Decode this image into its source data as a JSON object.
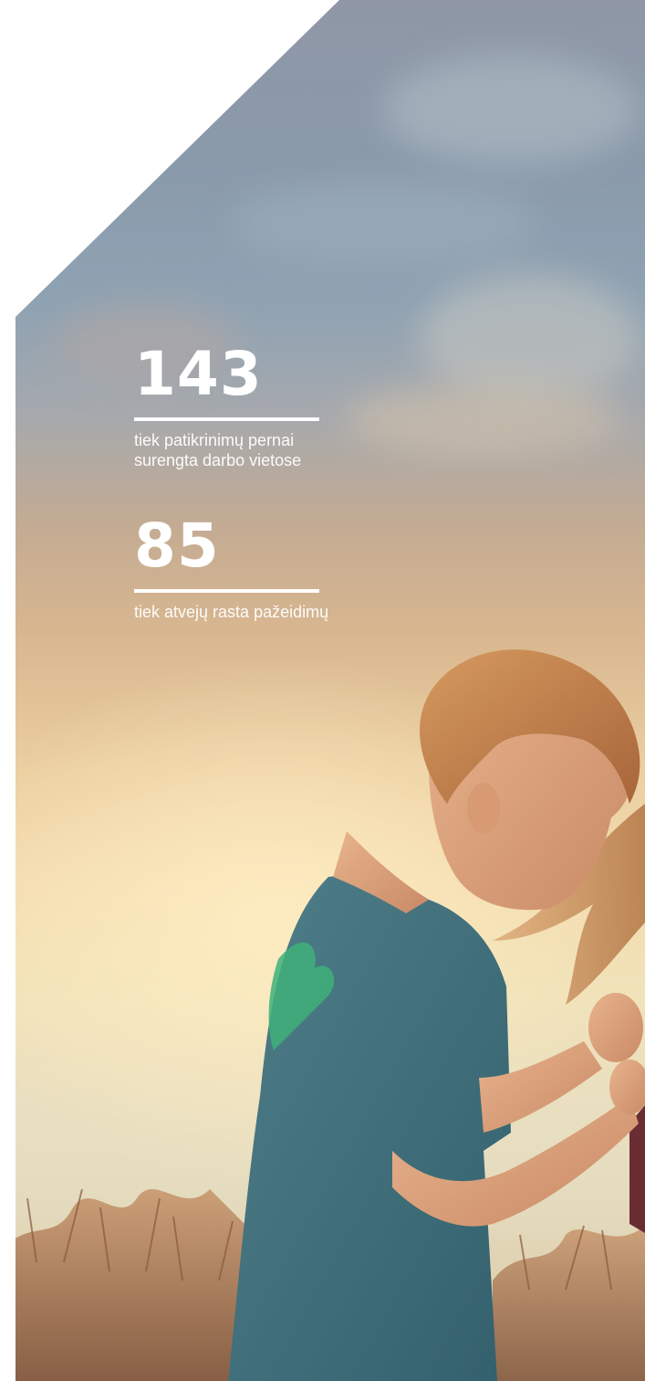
{
  "stats": [
    {
      "number": "143",
      "caption": "tiek patikrinimų pernai surengta darbo vietose"
    },
    {
      "number": "85",
      "caption": "tiek atvejų rasta pažeidimų"
    }
  ],
  "colors": {
    "text": "#ffffff",
    "sky_top": "#8f97a6",
    "sky_glow": "#f3dcaf",
    "shirt": "#3f6f7c",
    "shirt_print": "#3fb07a"
  }
}
